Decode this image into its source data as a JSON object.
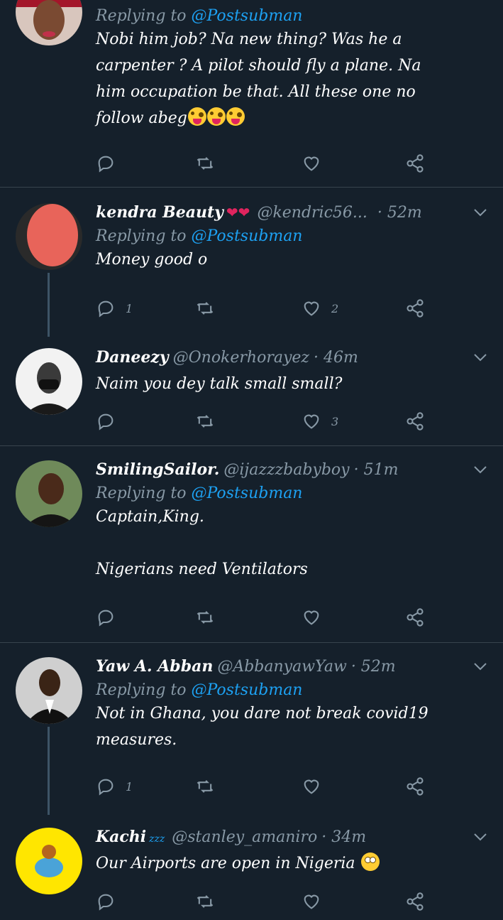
{
  "colors": {
    "background": "#15202b",
    "accent": "#1da1f2",
    "muted": "#8899a6",
    "heart": "#e0245e"
  },
  "tweets": [
    {
      "reply_prefix": "Replying to",
      "reply_to": "@Postsubman",
      "text": "Nobi him job? Na new thing? Was he a\ncarpenter ? A pilot should fly a plane. Na\nhim occupation be that. All these one no\nfollow abeg",
      "text_emoji": "zany-face-emoji x3",
      "replies": "",
      "likes": ""
    },
    {
      "name": "kendra Beauty",
      "name_suffix": "❤❤",
      "handle": "@kendric56...",
      "time": "· 52m",
      "reply_prefix": "Replying to",
      "reply_to": "@Postsubman",
      "text": "Money good o",
      "replies": "1",
      "likes": "2"
    },
    {
      "name": "Daneezy",
      "handle": "@Onokerhorayez",
      "time": "· 46m",
      "text": "Naim you dey talk small small?",
      "replies": "",
      "likes": "3"
    },
    {
      "name": "SmilingSailor.",
      "handle": "@ijazzzbabyboy",
      "time": "· 51m",
      "reply_prefix": "Replying to",
      "reply_to": "@Postsubman",
      "text": "Captain,King.\n\nNigerians need Ventilators",
      "replies": "",
      "likes": ""
    },
    {
      "name": "Yaw A. Abban",
      "handle": "@AbbanyawYaw",
      "time": "· 52m",
      "reply_prefix": "Replying to",
      "reply_to": "@Postsubman",
      "text": "Not in Ghana, you dare not break covid19\nmeasures.",
      "replies": "1",
      "likes": ""
    },
    {
      "name": "Kachi",
      "name_suffix": "zzz",
      "handle": "@stanley_amaniro",
      "time": "· 34m",
      "text": "Our Airports are open in Nigeria",
      "text_emoji": "face-with-rolling-eyes-emoji",
      "replies": "",
      "likes": ""
    }
  ],
  "icons": {
    "reply": "reply-icon",
    "retweet": "retweet-icon",
    "like": "heart-icon",
    "share": "share-icon",
    "more": "chevron-down-icon"
  }
}
